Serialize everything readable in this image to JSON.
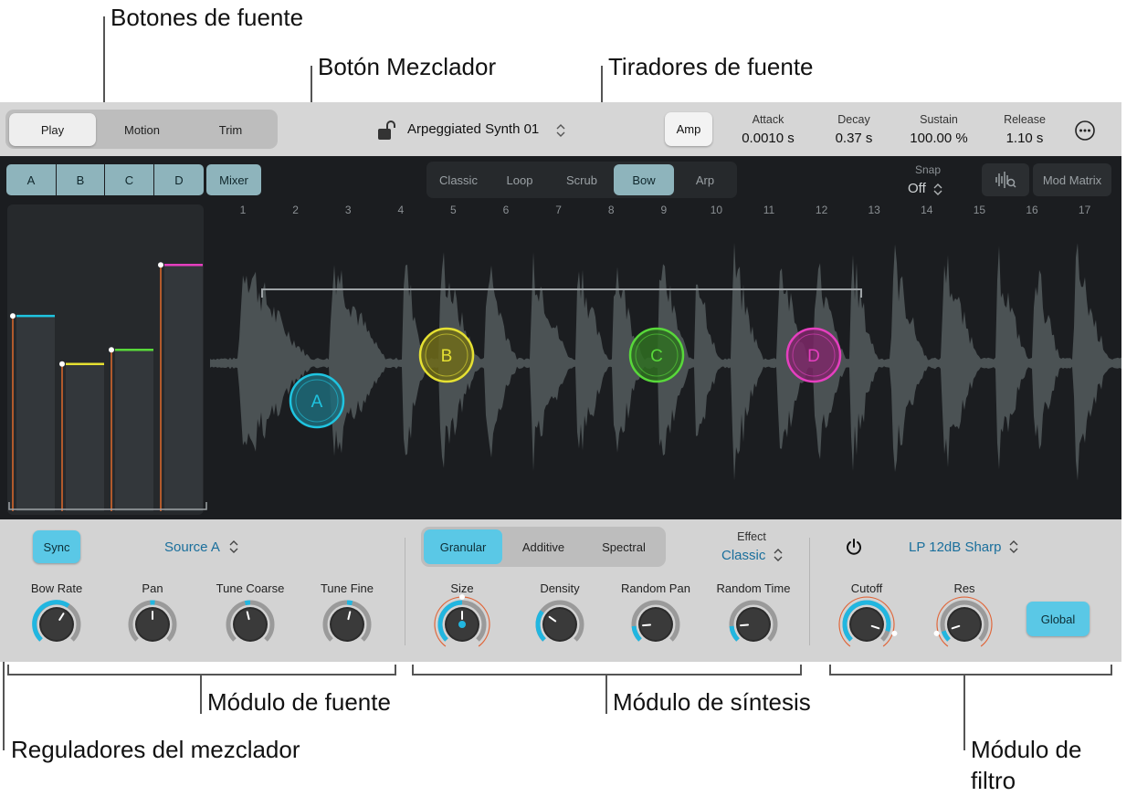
{
  "callouts": {
    "source_buttons": "Botones de fuente",
    "mixer_button": "Botón Mezclador",
    "source_handles": "Tiradores de fuente",
    "source_module": "Módulo de fuente",
    "synthesis_module": "Módulo de síntesis",
    "mixer_faders": "Reguladores del mezclador",
    "filter_module_line1": "Módulo de",
    "filter_module_line2": "filtro"
  },
  "topbar": {
    "modes": [
      "Play",
      "Motion",
      "Trim"
    ],
    "preset_name": "Arpeggiated Synth 01",
    "amp_label": "Amp",
    "envelope": [
      {
        "label": "Attack",
        "value": "0.0010 s"
      },
      {
        "label": "Decay",
        "value": "0.37 s"
      },
      {
        "label": "Sustain",
        "value": "100.00 %"
      },
      {
        "label": "Release",
        "value": "1.10 s"
      }
    ]
  },
  "sources": [
    "A",
    "B",
    "C",
    "D"
  ],
  "mixer_label": "Mixer",
  "play_modes": [
    "Classic",
    "Loop",
    "Scrub",
    "Bow",
    "Arp"
  ],
  "snap": {
    "label": "Snap",
    "value": "Off"
  },
  "mod_matrix_label": "Mod Matrix",
  "ruler": [
    "1",
    "2",
    "3",
    "4",
    "5",
    "6",
    "7",
    "8",
    "9",
    "10",
    "11",
    "12",
    "13",
    "14",
    "15",
    "16",
    "17"
  ],
  "mixer_levels": [
    0.69,
    0.52,
    0.57,
    0.87
  ],
  "colors": {
    "A": "#1fc4e0",
    "B": "#e5e032",
    "C": "#58d83a",
    "D": "#e53fbf",
    "accent": "#5ac8e6"
  },
  "source_module": {
    "sync_label": "Sync",
    "source_select": "Source A",
    "knobs": [
      {
        "label": "Bow Rate",
        "value": 0.62
      },
      {
        "label": "Pan",
        "value": 0.5
      },
      {
        "label": "Tune Coarse",
        "value": 0.45
      },
      {
        "label": "Tune Fine",
        "value": 0.55
      }
    ]
  },
  "synth_module": {
    "modes": [
      "Granular",
      "Additive",
      "Spectral"
    ],
    "effect_label": "Effect",
    "effect_value": "Classic",
    "knobs": [
      {
        "label": "Size",
        "value": 0.5
      },
      {
        "label": "Density",
        "value": 0.3
      },
      {
        "label": "Random Pan",
        "value": 0.15
      },
      {
        "label": "Random Time",
        "value": 0.15
      }
    ]
  },
  "filter_module": {
    "type": "LP 12dB Sharp",
    "global_label": "Global",
    "knobs": [
      {
        "label": "Cutoff",
        "value": 0.9
      },
      {
        "label": "Res",
        "value": 0.1
      }
    ]
  }
}
